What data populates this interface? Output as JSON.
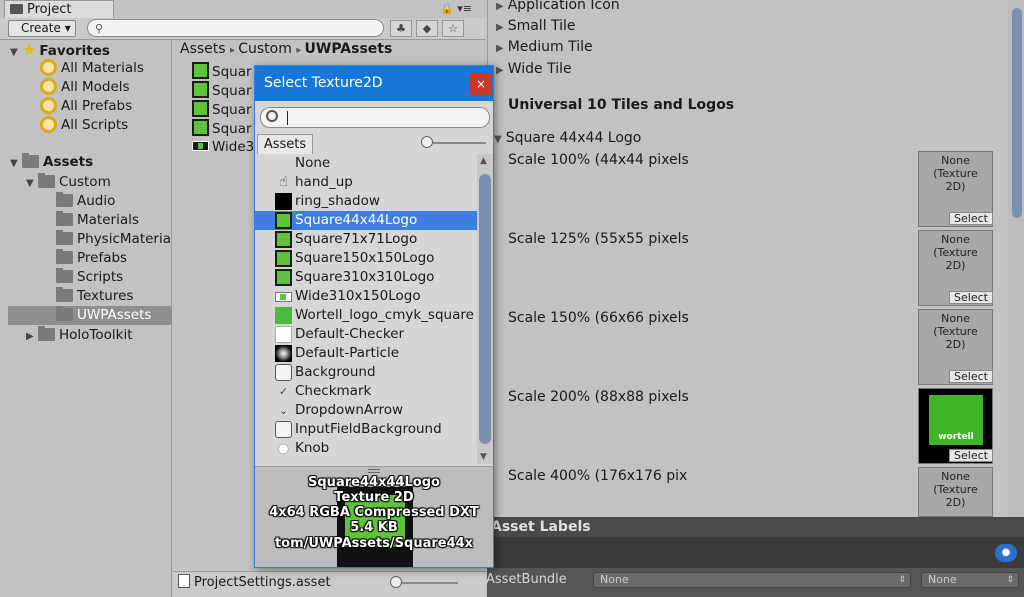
{
  "project_panel": {
    "tab_title": "Project",
    "menu_icons": "🔒 ▾≡",
    "create_label": "Create ▾",
    "search": {
      "placeholder": ""
    },
    "favorites": {
      "header": "Favorites",
      "items": [
        "All Materials",
        "All Models",
        "All Prefabs",
        "All Scripts"
      ]
    },
    "assets_tree": {
      "header": "Assets",
      "custom": "Custom",
      "children": [
        "Audio",
        "Materials",
        "PhysicMateria",
        "Prefabs",
        "Scripts",
        "Textures",
        "UWPAssets"
      ],
      "holotoolkit": "HoloToolkit"
    },
    "breadcrumb": [
      "Assets",
      "Custom",
      "UWPAssets"
    ],
    "grid_items": [
      "Squar",
      "Squar",
      "Squar",
      "Squar",
      "Wide3"
    ],
    "bottom_file": "ProjectSettings.asset"
  },
  "dialog": {
    "title": "Select Texture2D",
    "close": "×",
    "assets_tab": "Assets",
    "items": [
      {
        "label": "None",
        "icon": "none"
      },
      {
        "label": "hand_up",
        "icon": "hand-icon"
      },
      {
        "label": "ring_shadow",
        "icon": "black-texture-icon"
      },
      {
        "label": "Square44x44Logo",
        "icon": "green-texture-icon",
        "selected": true
      },
      {
        "label": "Square71x71Logo",
        "icon": "green-texture-icon"
      },
      {
        "label": "Square150x150Logo",
        "icon": "green-texture-icon"
      },
      {
        "label": "Square310x310Logo",
        "icon": "green-texture-icon"
      },
      {
        "label": "Wide310x150Logo",
        "icon": "wide-texture-icon"
      },
      {
        "label": "Wortell_logo_cmyk_square",
        "icon": "logo-texture-icon"
      },
      {
        "label": "Default-Checker",
        "icon": "checker-icon"
      },
      {
        "label": "Default-Particle",
        "icon": "particle-icon"
      },
      {
        "label": "Background",
        "icon": "background-icon"
      },
      {
        "label": "Checkmark",
        "icon": "checkmark-icon"
      },
      {
        "label": "DropdownArrow",
        "icon": "dropdown-arrow-icon"
      },
      {
        "label": "InputFieldBackground",
        "icon": "background-icon"
      },
      {
        "label": "Knob",
        "icon": "knob-icon"
      }
    ],
    "preview": {
      "name": "Square44x44Logo",
      "type": "Texture 2D",
      "info": "4x64  RGBA Compressed DXT",
      "size": "5.4 KB",
      "path": "tom/UWPAssets/Square44x"
    }
  },
  "inspector": {
    "rows_top": [
      "Application Icon",
      "Small Tile",
      "Medium Tile",
      "Wide Tile"
    ],
    "section_title": "Universal 10 Tiles and Logos",
    "foldout": "Square 44x44 Logo",
    "scales": [
      {
        "label": "Scale 100% (44x44 pixels",
        "slot": "None\n(Texture\n2D)"
      },
      {
        "label": "Scale 125% (55x55 pixels",
        "slot": "None\n(Texture\n2D)"
      },
      {
        "label": "Scale 150% (66x66 pixels",
        "slot": "None\n(Texture\n2D)"
      },
      {
        "label": "Scale 200% (88x88 pixels",
        "slot": "wortell"
      },
      {
        "label": "Scale 400% (176x176 pix",
        "slot": "None\n(Texture\n2D)"
      }
    ],
    "select_label": "Select"
  },
  "asset_labels": {
    "header": "Asset Labels",
    "bundle_label": "AssetBundle",
    "bundle_value": "None",
    "variant_value": "None"
  },
  "colors": {
    "selection_blue": "#3d7ee0",
    "title_blue": "#1777d6",
    "close_red": "#c8372c",
    "texture_green": "#5ec23b"
  }
}
